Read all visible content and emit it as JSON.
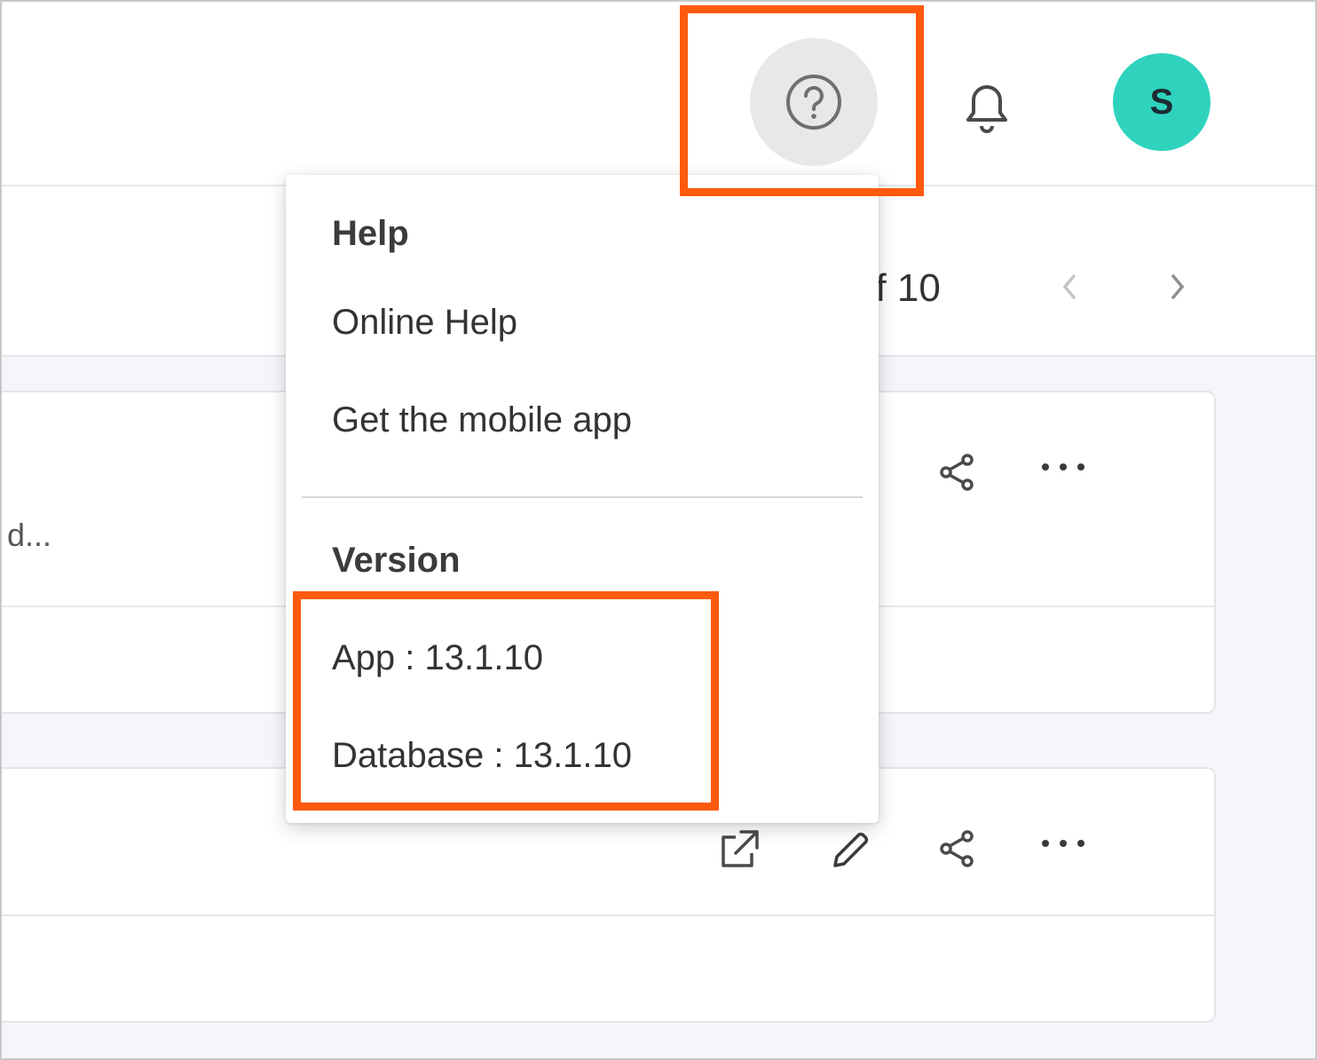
{
  "header": {
    "help_icon": "question-circle-icon",
    "notification_icon": "bell-icon",
    "avatar_initial": "S",
    "avatar_color": "#2fd3bd"
  },
  "pager": {
    "text": "of 10",
    "prev_icon": "chevron-left-icon",
    "next_icon": "chevron-right-icon"
  },
  "cards": [
    {
      "snippet": "d...",
      "actions": [
        "share-icon",
        "more-icon"
      ]
    },
    {
      "actions": [
        "open-external-icon",
        "edit-icon",
        "share-icon",
        "more-icon"
      ]
    }
  ],
  "help_menu": {
    "heading": "Help",
    "items": [
      "Online Help",
      "Get the mobile app"
    ],
    "version_heading": "Version",
    "app_version": "App : 13.1.10",
    "database_version": "Database : 13.1.10"
  },
  "highlight_color": "#ff5a0d"
}
